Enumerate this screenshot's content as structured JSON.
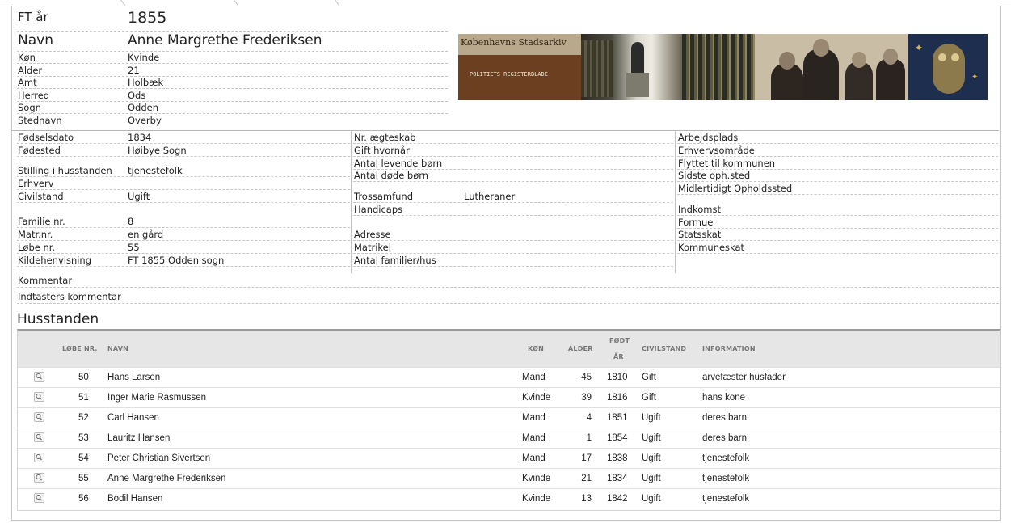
{
  "header": {
    "ft_label": "FT år",
    "ft_value": "1855",
    "navn_label": "Navn",
    "navn_value": "Anne Margrethe Frederiksen"
  },
  "person": [
    {
      "label": "Køn",
      "value": "Kvinde"
    },
    {
      "label": "Alder",
      "value": "21"
    },
    {
      "label": "Amt",
      "value": "Holbæk"
    },
    {
      "label": "Herred",
      "value": "Ods"
    },
    {
      "label": "Sogn",
      "value": "Odden"
    },
    {
      "label": "Stednavn",
      "value": "Overby"
    }
  ],
  "banner": {
    "title": "Københavns Stadsarkiv",
    "subtitle": "POLITIETS REGISTERBLADE"
  },
  "col1": [
    {
      "label": "Fødselsdato",
      "value": "1834"
    },
    {
      "label": "Fødested",
      "value": "Høibye Sogn"
    },
    {
      "label": "Stilling i husstanden",
      "value": "tjenestefolk"
    },
    {
      "label": "Erhverv",
      "value": ""
    },
    {
      "label": "Civilstand",
      "value": "Ugift"
    },
    {
      "label": "Familie nr.",
      "value": "8"
    },
    {
      "label": "Matr.nr.",
      "value": "en gård"
    },
    {
      "label": "Løbe nr.",
      "value": "55"
    },
    {
      "label": "Kildehenvisning",
      "value": "FT 1855 Odden sogn"
    }
  ],
  "col2": [
    {
      "label": "Nr. ægteskab",
      "value": ""
    },
    {
      "label": "Gift hvornår",
      "value": ""
    },
    {
      "label": "Antal levende børn",
      "value": ""
    },
    {
      "label": "Antal døde børn",
      "value": ""
    },
    {
      "label": "Trossamfund",
      "value": "Lutheraner"
    },
    {
      "label": "Handicaps",
      "value": ""
    },
    {
      "label": "Adresse",
      "value": ""
    },
    {
      "label": "Matrikel",
      "value": ""
    },
    {
      "label": "Antal familier/hus",
      "value": ""
    }
  ],
  "col3": [
    {
      "label": "Arbejdsplads"
    },
    {
      "label": "Erhvervsområde"
    },
    {
      "label": "Flyttet til kommunen"
    },
    {
      "label": "Sidste oph.sted"
    },
    {
      "label": "Midlertidigt Opholdssted"
    },
    {
      "label": "Indkomst"
    },
    {
      "label": "Formue"
    },
    {
      "label": "Statsskat"
    },
    {
      "label": "Kommuneskat"
    }
  ],
  "comments": {
    "kommentar": "Kommentar",
    "indtaster": "Indtasters kommentar"
  },
  "household": {
    "title": "Husstanden",
    "headers": {
      "lobe": "LØBE NR.",
      "navn": "NAVN",
      "kon": "KØN",
      "alder": "ALDER",
      "fodt1": "FØDT",
      "fodt2": "ÅR",
      "civil": "CIVILSTAND",
      "info": "INFORMATION"
    },
    "rows": [
      {
        "lobe": "50",
        "navn": "Hans Larsen",
        "kon": "Mand",
        "alder": "45",
        "fodt": "1810",
        "civil": "Gift",
        "info": "arvefæster husfader"
      },
      {
        "lobe": "51",
        "navn": "Inger Marie Rasmussen",
        "kon": "Kvinde",
        "alder": "39",
        "fodt": "1816",
        "civil": "Gift",
        "info": "hans kone"
      },
      {
        "lobe": "52",
        "navn": "Carl Hansen",
        "kon": "Mand",
        "alder": "4",
        "fodt": "1851",
        "civil": "Ugift",
        "info": "deres barn"
      },
      {
        "lobe": "53",
        "navn": "Lauritz Hansen",
        "kon": "Mand",
        "alder": "1",
        "fodt": "1854",
        "civil": "Ugift",
        "info": "deres barn"
      },
      {
        "lobe": "54",
        "navn": "Peter Christian Sivertsen",
        "kon": "Mand",
        "alder": "17",
        "fodt": "1838",
        "civil": "Ugift",
        "info": "tjenestefolk"
      },
      {
        "lobe": "55",
        "navn": "Anne Margrethe Frederiksen",
        "kon": "Kvinde",
        "alder": "21",
        "fodt": "1834",
        "civil": "Ugift",
        "info": "tjenestefolk"
      },
      {
        "lobe": "56",
        "navn": "Bodil Hansen",
        "kon": "Kvinde",
        "alder": "13",
        "fodt": "1842",
        "civil": "Ugift",
        "info": "tjenestefolk"
      }
    ]
  }
}
